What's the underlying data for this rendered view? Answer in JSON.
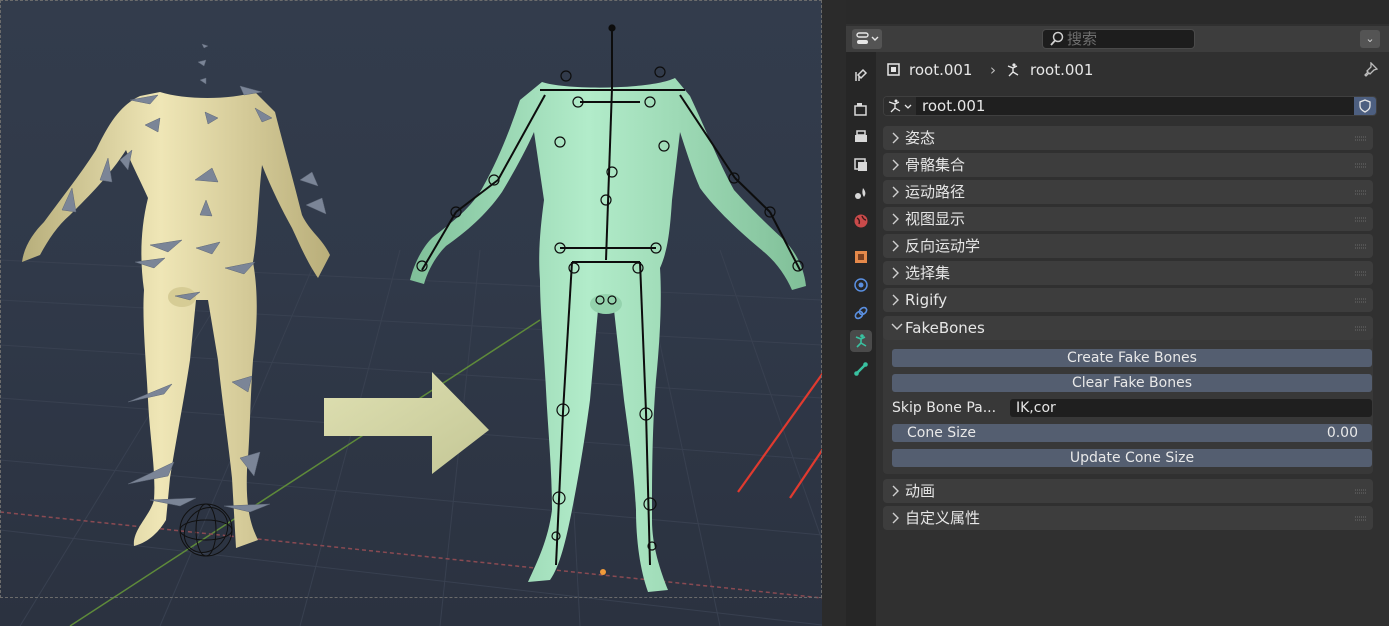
{
  "header": {
    "search_placeholder": "搜索",
    "options_glyph": "⌄"
  },
  "tabs": [
    {
      "name": "tool-tab-icon"
    },
    {
      "name": "render-tab-icon"
    },
    {
      "name": "output-tab-icon"
    },
    {
      "name": "view-layer-tab-icon"
    },
    {
      "name": "scene-tab-icon"
    },
    {
      "name": "world-tab-icon"
    },
    {
      "name": "object-tab-icon"
    },
    {
      "name": "physics-tab-icon"
    },
    {
      "name": "constraints-tab-icon"
    },
    {
      "name": "object-data-armature-tab-icon",
      "active": true
    },
    {
      "name": "bone-tab-icon"
    }
  ],
  "breadcrumb": {
    "object": "root.001",
    "separator": "›",
    "data": "root.001"
  },
  "data_block": {
    "name": "root.001"
  },
  "panels": [
    {
      "label": "姿态"
    },
    {
      "label": "骨骼集合"
    },
    {
      "label": "运动路径"
    },
    {
      "label": "视图显示"
    },
    {
      "label": "反向运动学"
    },
    {
      "label": "选择集"
    },
    {
      "label": "Rigify"
    }
  ],
  "fakebones": {
    "title": "FakeBones",
    "create_label": "Create Fake Bones",
    "clear_label": "Clear Fake Bones",
    "skip_label": "Skip Bone Pa...",
    "skip_value": "IK,cor",
    "cone_label": "Cone Size",
    "cone_value": "0.00",
    "update_label": "Update Cone Size"
  },
  "panels_after": [
    {
      "label": "动画"
    },
    {
      "label": "自定义属性"
    }
  ],
  "colors": {
    "accent_active_tab": "#39c1a0",
    "arrow_red": "#e03a2f",
    "button_blue": "#545e70",
    "left_model": "#e0d7a4",
    "right_model": "#a3dcb8",
    "bone_cones": "#7b8597"
  }
}
